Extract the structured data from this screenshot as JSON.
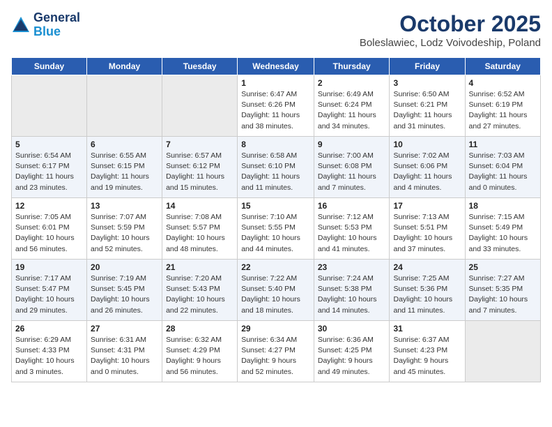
{
  "header": {
    "logo_line1": "General",
    "logo_line2": "Blue",
    "month": "October 2025",
    "location": "Boleslawiec, Lodz Voivodeship, Poland"
  },
  "weekdays": [
    "Sunday",
    "Monday",
    "Tuesday",
    "Wednesday",
    "Thursday",
    "Friday",
    "Saturday"
  ],
  "weeks": [
    [
      {
        "num": "",
        "info": ""
      },
      {
        "num": "",
        "info": ""
      },
      {
        "num": "",
        "info": ""
      },
      {
        "num": "1",
        "info": "Sunrise: 6:47 AM\nSunset: 6:26 PM\nDaylight: 11 hours\nand 38 minutes."
      },
      {
        "num": "2",
        "info": "Sunrise: 6:49 AM\nSunset: 6:24 PM\nDaylight: 11 hours\nand 34 minutes."
      },
      {
        "num": "3",
        "info": "Sunrise: 6:50 AM\nSunset: 6:21 PM\nDaylight: 11 hours\nand 31 minutes."
      },
      {
        "num": "4",
        "info": "Sunrise: 6:52 AM\nSunset: 6:19 PM\nDaylight: 11 hours\nand 27 minutes."
      }
    ],
    [
      {
        "num": "5",
        "info": "Sunrise: 6:54 AM\nSunset: 6:17 PM\nDaylight: 11 hours\nand 23 minutes."
      },
      {
        "num": "6",
        "info": "Sunrise: 6:55 AM\nSunset: 6:15 PM\nDaylight: 11 hours\nand 19 minutes."
      },
      {
        "num": "7",
        "info": "Sunrise: 6:57 AM\nSunset: 6:12 PM\nDaylight: 11 hours\nand 15 minutes."
      },
      {
        "num": "8",
        "info": "Sunrise: 6:58 AM\nSunset: 6:10 PM\nDaylight: 11 hours\nand 11 minutes."
      },
      {
        "num": "9",
        "info": "Sunrise: 7:00 AM\nSunset: 6:08 PM\nDaylight: 11 hours\nand 7 minutes."
      },
      {
        "num": "10",
        "info": "Sunrise: 7:02 AM\nSunset: 6:06 PM\nDaylight: 11 hours\nand 4 minutes."
      },
      {
        "num": "11",
        "info": "Sunrise: 7:03 AM\nSunset: 6:04 PM\nDaylight: 11 hours\nand 0 minutes."
      }
    ],
    [
      {
        "num": "12",
        "info": "Sunrise: 7:05 AM\nSunset: 6:01 PM\nDaylight: 10 hours\nand 56 minutes."
      },
      {
        "num": "13",
        "info": "Sunrise: 7:07 AM\nSunset: 5:59 PM\nDaylight: 10 hours\nand 52 minutes."
      },
      {
        "num": "14",
        "info": "Sunrise: 7:08 AM\nSunset: 5:57 PM\nDaylight: 10 hours\nand 48 minutes."
      },
      {
        "num": "15",
        "info": "Sunrise: 7:10 AM\nSunset: 5:55 PM\nDaylight: 10 hours\nand 44 minutes."
      },
      {
        "num": "16",
        "info": "Sunrise: 7:12 AM\nSunset: 5:53 PM\nDaylight: 10 hours\nand 41 minutes."
      },
      {
        "num": "17",
        "info": "Sunrise: 7:13 AM\nSunset: 5:51 PM\nDaylight: 10 hours\nand 37 minutes."
      },
      {
        "num": "18",
        "info": "Sunrise: 7:15 AM\nSunset: 5:49 PM\nDaylight: 10 hours\nand 33 minutes."
      }
    ],
    [
      {
        "num": "19",
        "info": "Sunrise: 7:17 AM\nSunset: 5:47 PM\nDaylight: 10 hours\nand 29 minutes."
      },
      {
        "num": "20",
        "info": "Sunrise: 7:19 AM\nSunset: 5:45 PM\nDaylight: 10 hours\nand 26 minutes."
      },
      {
        "num": "21",
        "info": "Sunrise: 7:20 AM\nSunset: 5:43 PM\nDaylight: 10 hours\nand 22 minutes."
      },
      {
        "num": "22",
        "info": "Sunrise: 7:22 AM\nSunset: 5:40 PM\nDaylight: 10 hours\nand 18 minutes."
      },
      {
        "num": "23",
        "info": "Sunrise: 7:24 AM\nSunset: 5:38 PM\nDaylight: 10 hours\nand 14 minutes."
      },
      {
        "num": "24",
        "info": "Sunrise: 7:25 AM\nSunset: 5:36 PM\nDaylight: 10 hours\nand 11 minutes."
      },
      {
        "num": "25",
        "info": "Sunrise: 7:27 AM\nSunset: 5:35 PM\nDaylight: 10 hours\nand 7 minutes."
      }
    ],
    [
      {
        "num": "26",
        "info": "Sunrise: 6:29 AM\nSunset: 4:33 PM\nDaylight: 10 hours\nand 3 minutes."
      },
      {
        "num": "27",
        "info": "Sunrise: 6:31 AM\nSunset: 4:31 PM\nDaylight: 10 hours\nand 0 minutes."
      },
      {
        "num": "28",
        "info": "Sunrise: 6:32 AM\nSunset: 4:29 PM\nDaylight: 9 hours\nand 56 minutes."
      },
      {
        "num": "29",
        "info": "Sunrise: 6:34 AM\nSunset: 4:27 PM\nDaylight: 9 hours\nand 52 minutes."
      },
      {
        "num": "30",
        "info": "Sunrise: 6:36 AM\nSunset: 4:25 PM\nDaylight: 9 hours\nand 49 minutes."
      },
      {
        "num": "31",
        "info": "Sunrise: 6:37 AM\nSunset: 4:23 PM\nDaylight: 9 hours\nand 45 minutes."
      },
      {
        "num": "",
        "info": ""
      }
    ]
  ]
}
